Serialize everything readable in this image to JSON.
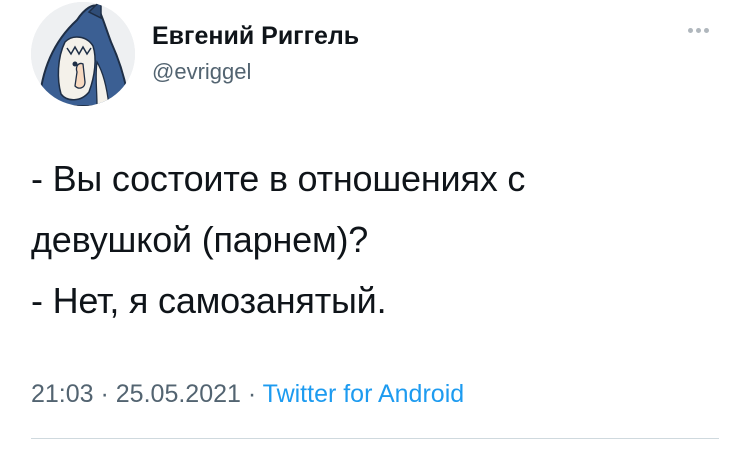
{
  "author": {
    "name": "Евгений Риггель",
    "handle": "@evriggel"
  },
  "tweet": {
    "lines": [
      "- Вы состоите в отношениях с",
      "девушкой (парнем)?",
      "- Нет, я самозанятый."
    ]
  },
  "meta": {
    "time": "21:03",
    "separator1": " · ",
    "date": "25.05.2021",
    "separator2": " · ",
    "source": "Twitter for Android"
  },
  "icons": {
    "more": "more-horizontal-icon",
    "avatar": "shark-costume-avatar"
  },
  "colors": {
    "source_link": "#1d9bf0",
    "secondary_text": "#536471",
    "divider": "#cfd9de"
  }
}
